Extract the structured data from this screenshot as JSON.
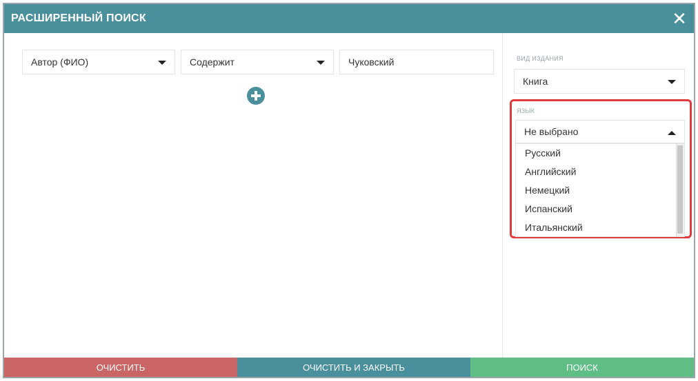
{
  "window": {
    "title": "РАСШИРЕННЫЙ ПОИСК",
    "close_glyph": "✕"
  },
  "query_row": {
    "field": "Автор (ФИО)",
    "operator": "Содержит",
    "value": "Чуковский"
  },
  "sidebar": {
    "edition_type": {
      "label": "ВИД ИЗДАНИЯ",
      "selected": "Книга"
    },
    "language": {
      "label": "ЯЗЫК",
      "selected": "Не выбрано",
      "options": [
        "Русский",
        "Английский",
        "Немецкий",
        "Испанский",
        "Итальянский"
      ]
    }
  },
  "footer": {
    "clear_label": "ОЧИСТИТЬ",
    "clear_close_label": "ОЧИСТИТЬ И ЗАКРЫТЬ",
    "search_label": "ПОИСК"
  },
  "colors": {
    "header": "#4a8f9c",
    "clear": "#c96565",
    "search": "#5fbe85",
    "highlight": "#e03b3b"
  },
  "icons": {
    "close": "close-icon",
    "add": "plus-circle-icon",
    "caret_down": "chevron-down-icon",
    "caret_up": "chevron-up-icon"
  }
}
